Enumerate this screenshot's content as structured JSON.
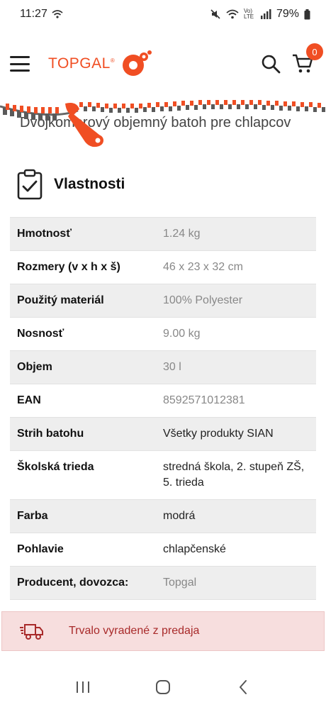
{
  "status_bar": {
    "time": "11:27",
    "battery": "79%",
    "network": "Vo) LTE"
  },
  "header": {
    "logo_text": "TOPGAL",
    "logo_registered": "®",
    "cart_count": "0",
    "icons": [
      "menu-icon",
      "search-icon",
      "cart-icon"
    ]
  },
  "product": {
    "title": "Dvojkomorový objemný batoh pre chlapcov"
  },
  "section": {
    "title": "Vlastnosti",
    "icon": "clipboard-check-icon"
  },
  "properties": [
    {
      "key": "Hmotnosť",
      "value": "1.24 kg"
    },
    {
      "key": "Rozmery (v x h x š)",
      "value": "46 x 23 x 32 cm"
    },
    {
      "key": "Použitý materiál",
      "value": "100% Polyester"
    },
    {
      "key": "Nosnosť",
      "value": "9.00 kg"
    },
    {
      "key": "Objem",
      "value": "30 l"
    },
    {
      "key": "EAN",
      "value": "8592571012381"
    },
    {
      "key": "Strih batohu",
      "value": "Všetky produkty SIAN"
    },
    {
      "key": "Školská trieda",
      "value": "stredná škola, 2. stupeň ZŠ, 5. trieda"
    },
    {
      "key": "Farba",
      "value": "modrá"
    },
    {
      "key": "Pohlavie",
      "value": "chlapčenské"
    },
    {
      "key": "Producent, dovozca:",
      "value": "Topgal"
    }
  ],
  "notice": {
    "text": "Trvalo vyradené z predaja",
    "icon": "delivery-truck-icon"
  },
  "colors": {
    "brand": "#f04e23",
    "notice_bg": "#f7dede",
    "notice_text": "#a82a2a"
  }
}
